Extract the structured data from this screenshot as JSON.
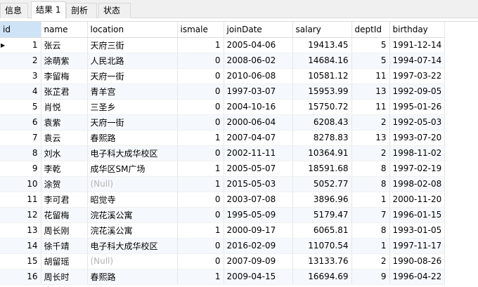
{
  "tabs": [
    {
      "label": "信息"
    },
    {
      "label": "结果 1"
    },
    {
      "label": "剖析"
    },
    {
      "label": "状态"
    }
  ],
  "active_tab": 1,
  "columns": [
    "id",
    "name",
    "location",
    "ismale",
    "joinDate",
    "salary",
    "deptId",
    "birthday"
  ],
  "null_text": "(Null)",
  "current_row_marker": "▶",
  "rows": [
    {
      "id": "1",
      "name": "张云",
      "location": "天府三街",
      "ismale": "1",
      "joinDate": "2005-04-06",
      "salary": "19413.45",
      "deptId": "5",
      "birthday": "1991-12-14"
    },
    {
      "id": "2",
      "name": "涂萌紫",
      "location": "人民北路",
      "ismale": "0",
      "joinDate": "2008-06-02",
      "salary": "14684.16",
      "deptId": "5",
      "birthday": "1994-07-14"
    },
    {
      "id": "3",
      "name": "李留梅",
      "location": "天府一街",
      "ismale": "0",
      "joinDate": "2010-06-08",
      "salary": "10581.12",
      "deptId": "11",
      "birthday": "1997-03-22"
    },
    {
      "id": "4",
      "name": "张芷君",
      "location": "青羊宫",
      "ismale": "0",
      "joinDate": "1997-03-07",
      "salary": "15953.99",
      "deptId": "13",
      "birthday": "1992-09-05"
    },
    {
      "id": "5",
      "name": "肖悦",
      "location": "三圣乡",
      "ismale": "0",
      "joinDate": "2004-10-16",
      "salary": "15750.72",
      "deptId": "11",
      "birthday": "1995-01-26"
    },
    {
      "id": "6",
      "name": "袁紫",
      "location": "天府一街",
      "ismale": "0",
      "joinDate": "2000-06-04",
      "salary": "6208.43",
      "deptId": "2",
      "birthday": "1992-05-03"
    },
    {
      "id": "7",
      "name": "袁云",
      "location": "春熙路",
      "ismale": "1",
      "joinDate": "2007-04-07",
      "salary": "8278.83",
      "deptId": "13",
      "birthday": "1993-07-20"
    },
    {
      "id": "8",
      "name": "刘水",
      "location": "电子科大成华校区",
      "ismale": "0",
      "joinDate": "2002-11-11",
      "salary": "10364.91",
      "deptId": "2",
      "birthday": "1998-11-02"
    },
    {
      "id": "9",
      "name": "李乾",
      "location": "成华区SM广场",
      "ismale": "1",
      "joinDate": "2005-05-07",
      "salary": "18591.68",
      "deptId": "8",
      "birthday": "1997-02-19"
    },
    {
      "id": "10",
      "name": "涂贺",
      "location": null,
      "ismale": "1",
      "joinDate": "2015-05-03",
      "salary": "5052.77",
      "deptId": "8",
      "birthday": "1998-02-08"
    },
    {
      "id": "11",
      "name": "李可君",
      "location": "昭觉寺",
      "ismale": "0",
      "joinDate": "2003-07-08",
      "salary": "3896.96",
      "deptId": "1",
      "birthday": "2000-11-20"
    },
    {
      "id": "12",
      "name": "花留梅",
      "location": "浣花溪公寓",
      "ismale": "0",
      "joinDate": "1995-05-09",
      "salary": "5179.47",
      "deptId": "7",
      "birthday": "1996-01-15"
    },
    {
      "id": "13",
      "name": "周长刚",
      "location": "浣花溪公寓",
      "ismale": "1",
      "joinDate": "2000-09-17",
      "salary": "6065.81",
      "deptId": "8",
      "birthday": "1993-01-05"
    },
    {
      "id": "14",
      "name": "徐千靖",
      "location": "电子科大成华校区",
      "ismale": "0",
      "joinDate": "2016-02-09",
      "salary": "11070.54",
      "deptId": "1",
      "birthday": "1997-11-17"
    },
    {
      "id": "15",
      "name": "胡留瑶",
      "location": null,
      "ismale": "0",
      "joinDate": "2007-09-09",
      "salary": "13133.76",
      "deptId": "2",
      "birthday": "1990-08-26"
    },
    {
      "id": "16",
      "name": "周长时",
      "location": "春熙路",
      "ismale": "1",
      "joinDate": "2009-04-15",
      "salary": "16694.69",
      "deptId": "9",
      "birthday": "1996-04-22"
    }
  ]
}
